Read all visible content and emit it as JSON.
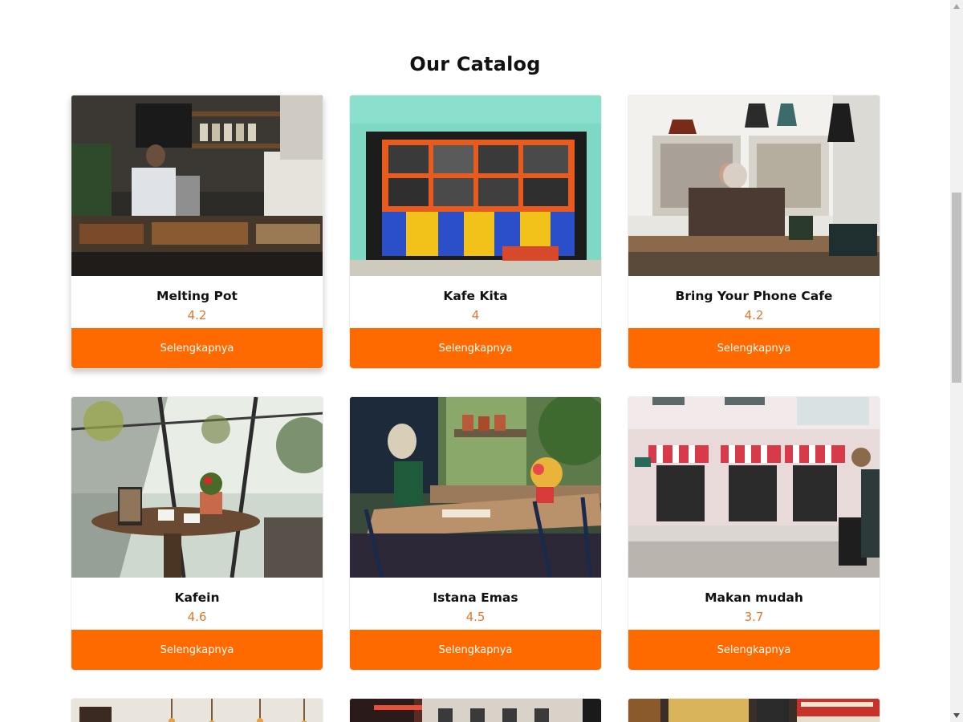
{
  "page": {
    "title": "Our Catalog"
  },
  "catalog": {
    "button_label": "Selengkapnya",
    "items": [
      {
        "name": "Melting Pot",
        "rating": "4.2",
        "image": "cafe-counter-barista-photo"
      },
      {
        "name": "Kafe Kita",
        "rating": "4",
        "image": "colorful-cafe-storefront-photo"
      },
      {
        "name": "Bring Your Phone Cafe",
        "rating": "4.2",
        "image": "old-man-in-cafe-photo"
      },
      {
        "name": "Kafein",
        "rating": "4.6",
        "image": "greenhouse-table-french-press-photo"
      },
      {
        "name": "Istana Emas",
        "rating": "4.5",
        "image": "outdoor-cafe-table-flowers-photo"
      },
      {
        "name": "Makan mudah",
        "rating": "3.7",
        "image": "cafe-storefront-awnings-photo"
      }
    ],
    "partial_items": [
      {
        "image": "cafe-interior-pendant-lights-photo"
      },
      {
        "image": "building-facade-photo"
      },
      {
        "image": "market-signs-photo"
      }
    ]
  },
  "colors": {
    "accent": "#ff6a00",
    "rating": "#e8762c",
    "title": "#111111"
  }
}
